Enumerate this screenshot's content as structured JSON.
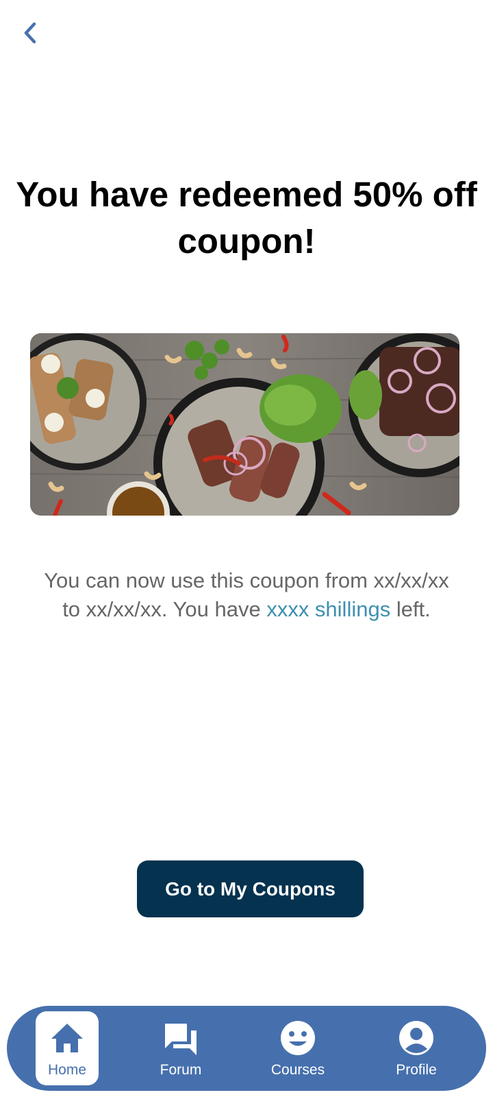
{
  "nav": {
    "back_icon": "chevron-left-icon"
  },
  "title": "You have redeemed 50% off coupon!",
  "hero": {
    "image": "food-bowls-photo"
  },
  "message": {
    "part1": "You can now use this coupon from xx/xx/xx to xx/xx/xx. You have ",
    "highlight": "xxxx shillings",
    "part2": " left."
  },
  "primary_button": {
    "label": "Go to My Coupons"
  },
  "tabbar": {
    "items": [
      {
        "label": "Home",
        "icon": "home-icon",
        "active": true
      },
      {
        "label": "Forum",
        "icon": "forum-icon",
        "active": false
      },
      {
        "label": "Courses",
        "icon": "smiley-icon",
        "active": false
      },
      {
        "label": "Profile",
        "icon": "profile-icon",
        "active": false
      }
    ]
  },
  "colors": {
    "brand_navy": "#04324f",
    "tabbar_blue": "#4670ad",
    "accent_link": "#3e8fb0",
    "body_text": "#666666"
  }
}
